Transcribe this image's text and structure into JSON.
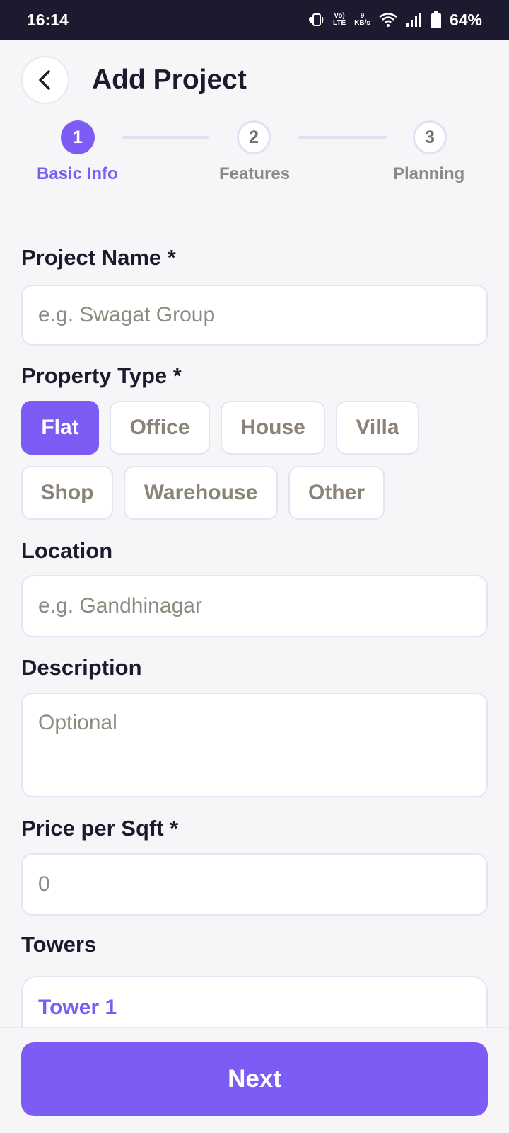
{
  "status_bar": {
    "time": "16:14",
    "volte_top": "Vo)",
    "volte_bottom": "LTE",
    "speed_value": "9",
    "speed_unit": "KB/s",
    "battery": "64%",
    "icons": [
      "vibrate-icon",
      "volte-icon",
      "wifi-icon",
      "signal-icon",
      "battery-icon"
    ]
  },
  "header": {
    "title": "Add Project",
    "back_icon": "chevron-left-icon"
  },
  "stepper": {
    "steps": [
      {
        "number": "1",
        "label": "Basic Info",
        "active": true
      },
      {
        "number": "2",
        "label": "Features",
        "active": false
      },
      {
        "number": "3",
        "label": "Planning",
        "active": false
      }
    ]
  },
  "form": {
    "project_name": {
      "label": "Project Name *",
      "value": "",
      "placeholder": "e.g. Swagat Group"
    },
    "property_type": {
      "label": "Property Type *",
      "selected": "Flat",
      "options": [
        "Flat",
        "Office",
        "House",
        "Villa",
        "Shop",
        "Warehouse",
        "Other"
      ]
    },
    "location": {
      "label": "Location",
      "value": "",
      "placeholder": "e.g. Gandhinagar"
    },
    "description": {
      "label": "Description",
      "value": "",
      "placeholder": "Optional"
    },
    "price": {
      "label": "Price per Sqft *",
      "value": "",
      "placeholder": "0"
    },
    "towers": {
      "label": "Towers",
      "items": [
        {
          "title": "Tower 1"
        }
      ]
    }
  },
  "footer": {
    "next_label": "Next"
  },
  "colors": {
    "accent": "#7c5cf5",
    "status_bar_bg": "#1b1a2e",
    "background": "#f6f6f8",
    "chip_text": "#8b8378"
  }
}
